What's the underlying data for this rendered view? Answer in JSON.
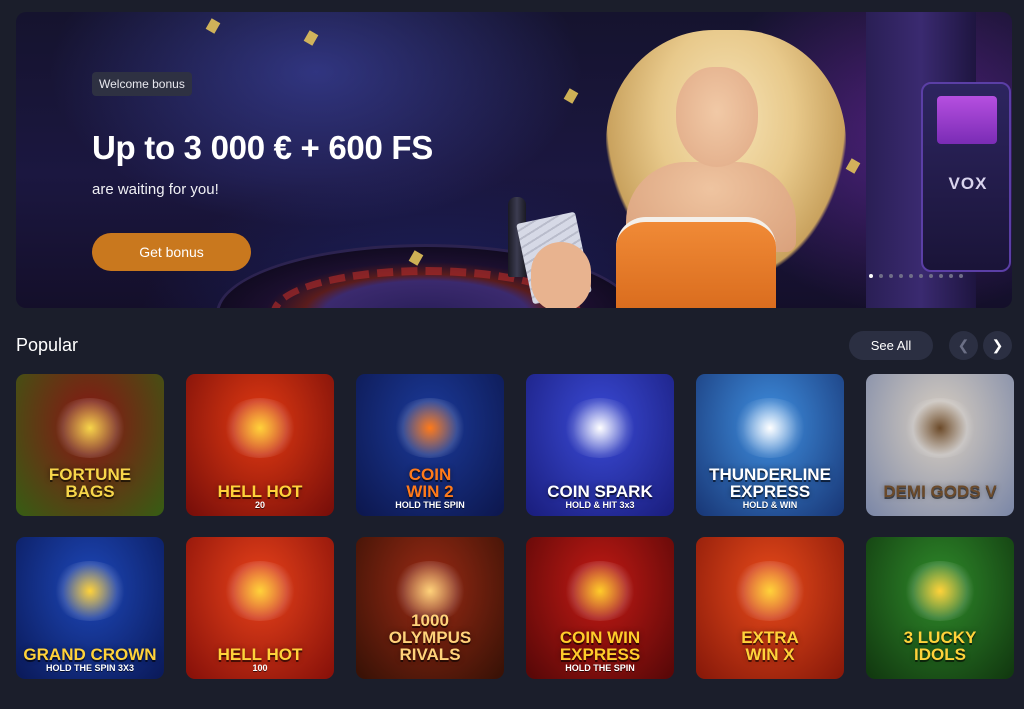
{
  "hero": {
    "badge": "Welcome bonus",
    "headline": "Up to 3 000 € + 600 FS",
    "subline": "are waiting for you!",
    "cta_label": "Get bonus",
    "brand_sign": "VOX",
    "slide_count": 10,
    "active_slide": 1,
    "accent_color": "#c9781e"
  },
  "popular": {
    "title": "Popular",
    "see_all_label": "See All",
    "prev_icon": "chevron-left-icon",
    "next_icon": "chevron-right-icon",
    "games": [
      {
        "name": "FORTUNE\nBAGS",
        "sub": "",
        "bg": "#8a1414",
        "bg2": "#3a5a14",
        "color": "#f7d64a"
      },
      {
        "name": "HELL HOT",
        "sub": "20",
        "bg": "#e23a12",
        "bg2": "#7a0f0a",
        "color": "#ffd23a"
      },
      {
        "name": "COIN\nWIN 2",
        "sub": "HOLD THE SPIN",
        "bg": "#1b3a9a",
        "bg2": "#0d1850",
        "color": "#ff7a1a"
      },
      {
        "name": "COIN SPARK",
        "sub": "HOLD & HIT 3x3",
        "bg": "#3a4ad6",
        "bg2": "#1b1f80",
        "color": "#ffffff"
      },
      {
        "name": "THUNDERLINE\nEXPRESS",
        "sub": "HOLD & WIN",
        "bg": "#3f8fe0",
        "bg2": "#1a3a7a",
        "color": "#ffffff"
      },
      {
        "name": "DEMI GODS V",
        "sub": "",
        "bg": "#d9cfc1",
        "bg2": "#7f8aa8",
        "color": "#6b4a2a"
      },
      {
        "name": "GRAND CROWN",
        "sub": "HOLD THE SPIN 3X3",
        "bg": "#1d47b8",
        "bg2": "#0b1b5c",
        "color": "#ffd23a"
      },
      {
        "name": "HELL HOT",
        "sub": "100",
        "bg": "#e8421a",
        "bg2": "#8a120a",
        "color": "#ffd23a"
      },
      {
        "name": "1000\nOLYMPUS\nRIVALS",
        "sub": "",
        "bg": "#9a2a14",
        "bg2": "#3a1206",
        "color": "#ffd27a"
      },
      {
        "name": "COIN WIN\nEXPRESS",
        "sub": "HOLD THE SPIN",
        "bg": "#c21a14",
        "bg2": "#5a0808",
        "color": "#ffcc2a"
      },
      {
        "name": "EXTRA\nWIN X",
        "sub": "",
        "bg": "#e84a1a",
        "bg2": "#8a1a0a",
        "color": "#ffd23a"
      },
      {
        "name": "3 LUCKY\nIDOLS",
        "sub": "",
        "bg": "#2f8a2a",
        "bg2": "#123a10",
        "color": "#ffd23a"
      }
    ]
  }
}
